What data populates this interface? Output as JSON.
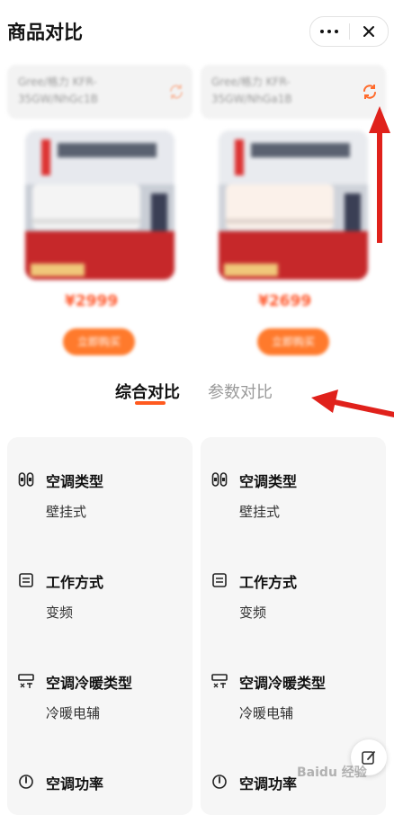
{
  "header": {
    "title": "商品对比"
  },
  "products": [
    {
      "name": "Gree/格力 KFR-35GW/NhGc1B",
      "price": "¥2999",
      "button": "立即购买"
    },
    {
      "name": "Gree/格力 KFR-35GW/NhGa1B",
      "price": "¥2699",
      "button": "立即购买"
    }
  ],
  "tabs": {
    "active": "综合对比",
    "inactive": "参数对比"
  },
  "specs": {
    "left": [
      {
        "label": "空调类型",
        "value": "壁挂式",
        "icon": "ac-type-icon"
      },
      {
        "label": "工作方式",
        "value": "变频",
        "icon": "work-mode-icon"
      },
      {
        "label": "空调冷暖类型",
        "value": "冷暖电辅",
        "icon": "cool-heat-icon"
      },
      {
        "label": "空调功率",
        "value": "",
        "icon": "power-icon"
      }
    ],
    "right": [
      {
        "label": "空调类型",
        "value": "壁挂式",
        "icon": "ac-type-icon"
      },
      {
        "label": "工作方式",
        "value": "变频",
        "icon": "work-mode-icon"
      },
      {
        "label": "空调冷暖类型",
        "value": "冷暖电辅",
        "icon": "cool-heat-icon"
      },
      {
        "label": "空调功率",
        "value": "",
        "icon": "power-icon"
      }
    ]
  },
  "watermark": "Baidu 经验",
  "colors": {
    "accent": "#ff5a1f",
    "annotation_arrow": "#e0211b"
  }
}
